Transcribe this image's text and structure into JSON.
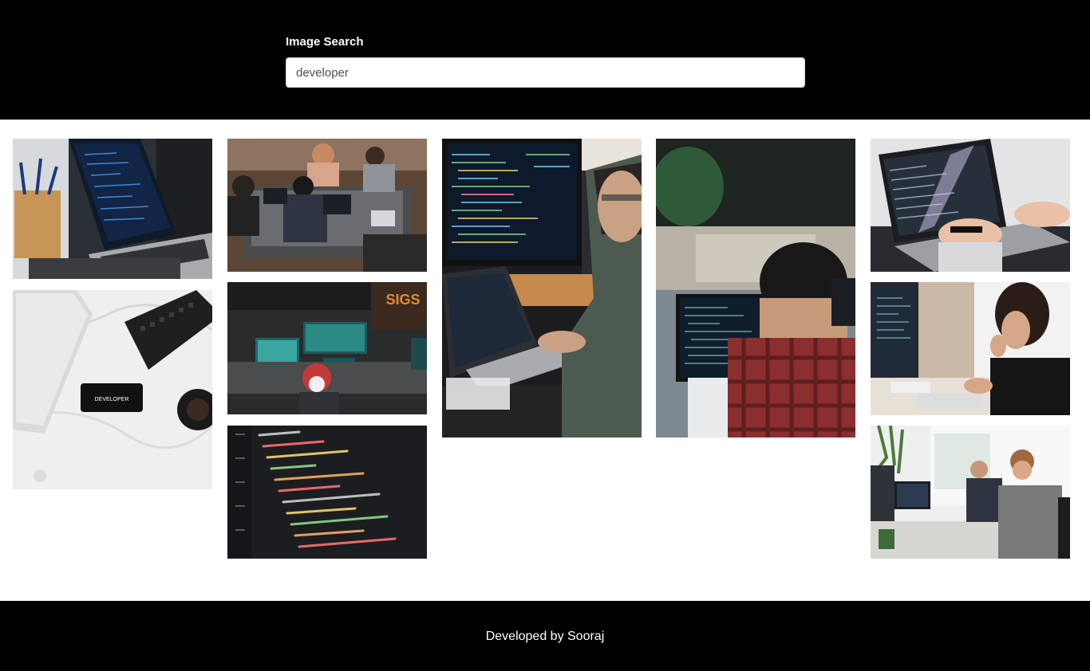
{
  "header": {
    "search_label": "Image Search",
    "search_value": "developer"
  },
  "gallery": {
    "images": [
      {
        "id": "img-laptop-code-pencils",
        "caption": ""
      },
      {
        "id": "img-phone-developer-keyboard",
        "caption": "DEVELOPER"
      },
      {
        "id": "img-team-around-table",
        "caption": ""
      },
      {
        "id": "img-office-workstations",
        "caption": "SIGS"
      },
      {
        "id": "img-code-closeup",
        "caption": ""
      },
      {
        "id": "img-man-coding-monitor",
        "caption": ""
      },
      {
        "id": "img-person-plaid-coding",
        "caption": ""
      },
      {
        "id": "img-hands-laptop-code",
        "caption": ""
      },
      {
        "id": "img-woman-at-computer",
        "caption": ""
      },
      {
        "id": "img-two-men-desk",
        "caption": ""
      }
    ]
  },
  "footer": {
    "text": "Developed by Sooraj"
  },
  "colors": {
    "header_bg": "#000000",
    "footer_bg": "#000000",
    "page_bg": "#ffffff"
  }
}
